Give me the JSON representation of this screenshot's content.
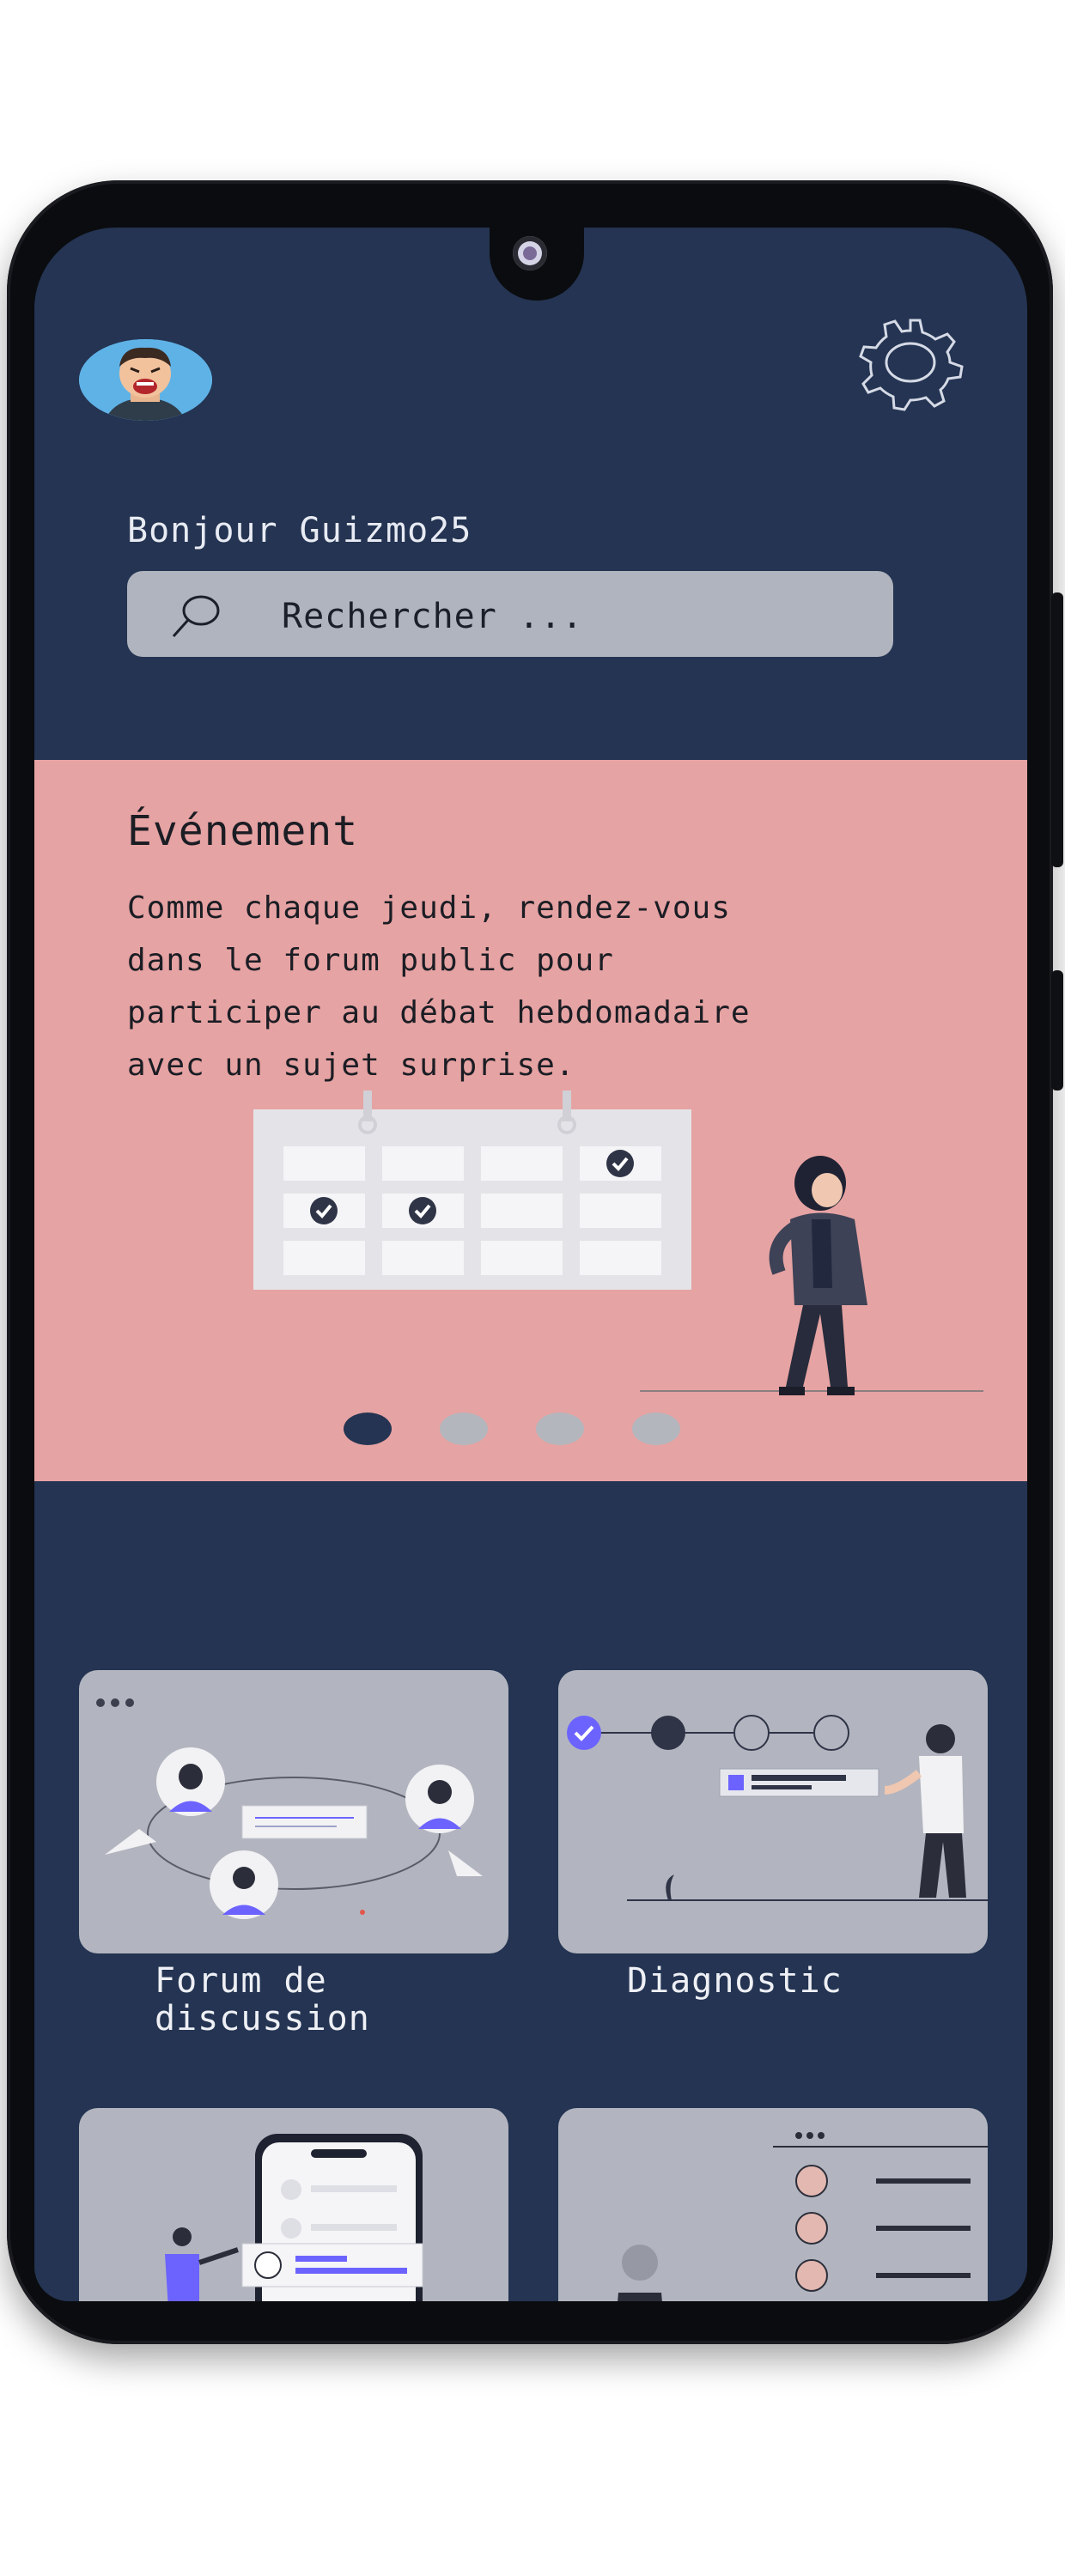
{
  "user": {
    "greeting": "Bonjour Guizmo25"
  },
  "icons": {
    "avatar": "avatar",
    "settings": "gear-icon",
    "search": "search-icon"
  },
  "search": {
    "placeholder": "Rechercher ..."
  },
  "event": {
    "title": "Événement",
    "body": "Comme chaque jeudi, rendez-vous\ndans le forum public pour\nparticiper au débat hebdomadaire\navec un sujet surprise.",
    "carousel": {
      "count": 4,
      "active_index": 0
    }
  },
  "cards": [
    {
      "label": "Forum de\ndiscussion"
    },
    {
      "label": "Diagnostic"
    },
    {
      "label": ""
    },
    {
      "label": ""
    }
  ],
  "colors": {
    "background": "#243452",
    "event_background": "#e6a3a3",
    "card_background": "#b2b5bf",
    "accent": "#6c63ff"
  }
}
